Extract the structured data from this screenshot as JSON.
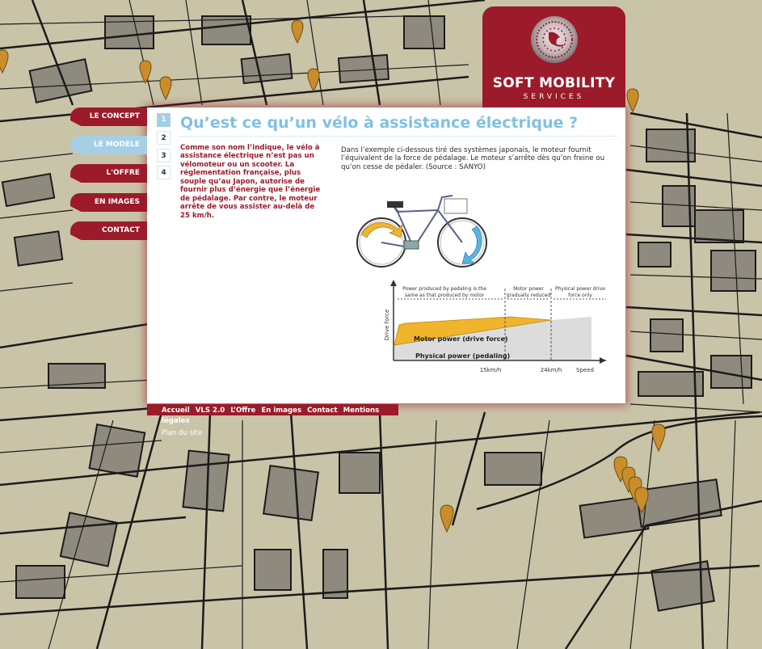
{
  "brand": {
    "name": "SOFT MOBILITY",
    "tagline": "SERVICES"
  },
  "nav": [
    {
      "label": "LE CONCEPT",
      "active": false
    },
    {
      "label": "LE MODELE",
      "active": true
    },
    {
      "label": "L'OFFRE",
      "active": false
    },
    {
      "label": "EN IMAGES",
      "active": false
    },
    {
      "label": "CONTACT",
      "active": false
    }
  ],
  "steps": [
    "1",
    "2",
    "3",
    "4"
  ],
  "page": {
    "title": "Qu’est ce qu’un vélo à assistance électrique ?",
    "intro": "Comme son nom l’indique, le vélo à assistance électrique n’est pas un vélomoteur ou un scooter. La réglementation française, plus souple qu’au Japon, autorise de fournir plus d’énergie que l’énergie de pédalage. Par contre, le moteur arrête de vous assister au-delà de 25 km/h.",
    "description": "Dans l’exemple ci-dessous tiré des systèmes japonais, le moteur fournit l’équivalent de la force de pédalage. Le moteur s’arrête dès qu’on freine ou qu’on cesse de pédaler. (Source : SANYO)"
  },
  "diagram": {
    "ylabel": "Drive force",
    "annotations": [
      "Power produced by pedaling is the",
      "same as that produced by motor",
      "Motor power",
      "gradually reduced",
      "Physical power drive",
      "force only"
    ],
    "motor_label": "Motor power (drive force)",
    "physical_label": "Physical power (pedaling)",
    "ticks": [
      "15km/h",
      "24km/h",
      "Speed"
    ]
  },
  "footer": {
    "links": [
      "Accueil",
      "VLS 2.0",
      "L’Offre",
      "En images",
      "Contact",
      "Mentions légales"
    ],
    "plan": "Plan du site"
  },
  "colors": {
    "brand": "#9b1b2a",
    "accent": "#a6cfe6",
    "title": "#7fc1e3",
    "map": "#c9c4a8"
  }
}
